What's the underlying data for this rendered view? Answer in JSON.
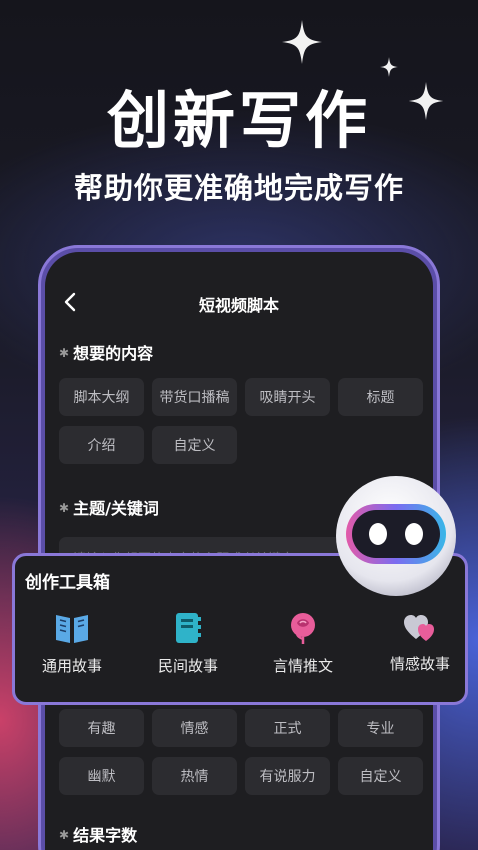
{
  "banner": {
    "headline": "创新写作",
    "subline": "帮助你更准确地完成写作"
  },
  "screen": {
    "title": "短视频脚本",
    "content_section": {
      "label": "想要的内容",
      "options": [
        "脚本大纲",
        "带货口播稿",
        "吸睛开头",
        "标题",
        "介绍",
        "自定义"
      ]
    },
    "topic_section": {
      "label": "主题/关键词",
      "placeholder": "请输入你想要的内容的主题或者关键字"
    },
    "tone_section": {
      "options": [
        "有趣",
        "情感",
        "正式",
        "专业",
        "幽默",
        "热情",
        "有说服力",
        "自定义"
      ]
    },
    "result_section": {
      "label": "结果字数"
    }
  },
  "toolbox": {
    "title": "创作工具箱",
    "tools": [
      {
        "label": "通用故事",
        "icon": "open-book-icon"
      },
      {
        "label": "民间故事",
        "icon": "notebook-icon"
      },
      {
        "label": "言情推文",
        "icon": "rose-icon"
      },
      {
        "label": "情感故事",
        "icon": "hearts-icon"
      }
    ]
  },
  "colors": {
    "accent": "#8a78d8",
    "icon_blue": "#5aa9e6",
    "icon_teal": "#2fb3c9",
    "icon_pink": "#e85d9a",
    "icon_gray": "#c9c9d4"
  }
}
